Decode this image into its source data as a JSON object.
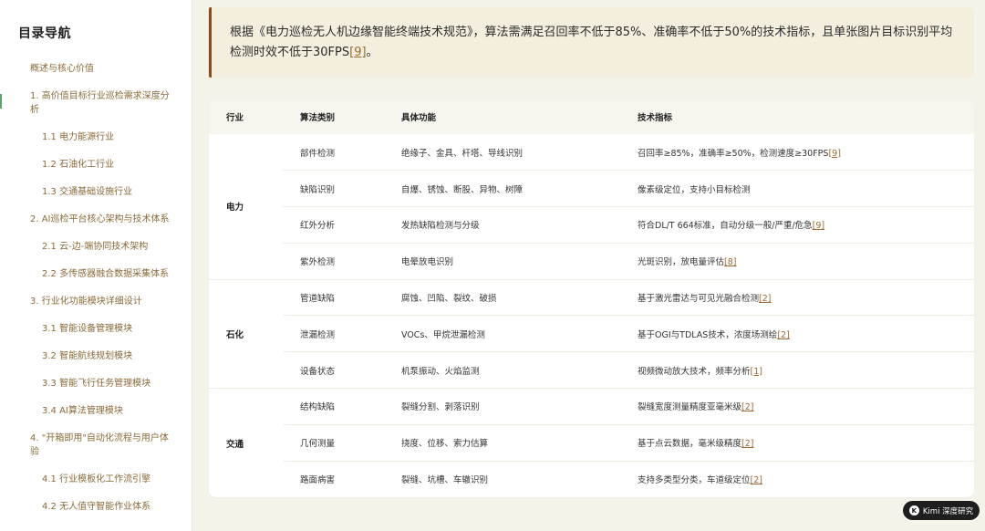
{
  "sidebar": {
    "title": "目录导航",
    "items": [
      {
        "label": "概述与核心价值",
        "level": 1
      },
      {
        "label": "1. 高价值目标行业巡检需求深度分析",
        "level": 1
      },
      {
        "label": "1.1 电力能源行业",
        "level": 2
      },
      {
        "label": "1.2 石油化工行业",
        "level": 2
      },
      {
        "label": "1.3 交通基础设施行业",
        "level": 2
      },
      {
        "label": "2. AI巡检平台核心架构与技术体系",
        "level": 1
      },
      {
        "label": "2.1 云-边-端协同技术架构",
        "level": 2
      },
      {
        "label": "2.2 多传感器融合数据采集体系",
        "level": 2
      },
      {
        "label": "3. 行业化功能模块详细设计",
        "level": 1
      },
      {
        "label": "3.1 智能设备管理模块",
        "level": 2
      },
      {
        "label": "3.2 智能航线规划模块",
        "level": 2
      },
      {
        "label": "3.3 智能飞行任务管理模块",
        "level": 2
      },
      {
        "label": "3.4 AI算法管理模块",
        "level": 2
      },
      {
        "label": "4. \"开箱即用\"自动化流程与用户体验",
        "level": 1
      },
      {
        "label": "4.1 行业模板化工作流引擎",
        "level": 2
      },
      {
        "label": "4.2 无人值守智能作业体系",
        "level": 2
      }
    ]
  },
  "callout": {
    "text": "根据《电力巡检无人机边缘智能终端技术规范》，算法需满足召回率不低于85%、准确率不低于50%的技术指标，且单张图片目标识别平均检测时效不低于30FPS",
    "ref": "[9]",
    "tail": "。"
  },
  "table": {
    "headers": [
      "行业",
      "算法类别",
      "具体功能",
      "技术指标"
    ],
    "groups": [
      {
        "industry": "电力",
        "rows": [
          {
            "category": "部件检测",
            "function": "绝缘子、金具、杆塔、导线识别",
            "spec": "召回率≥85%，准确率≥50%，检测速度≥30FPS",
            "ref": "[9]"
          },
          {
            "category": "缺陷识别",
            "function": "自爆、锈蚀、断股、异物、树障",
            "spec": "像素级定位，支持小目标检测",
            "ref": ""
          },
          {
            "category": "红外分析",
            "function": "发热缺陷检测与分级",
            "spec": "符合DL/T 664标准，自动分级一般/严重/危急",
            "ref": "[9]"
          },
          {
            "category": "紫外检测",
            "function": "电晕放电识别",
            "spec": "光斑识别，放电量评估",
            "ref": "[8]"
          }
        ]
      },
      {
        "industry": "石化",
        "rows": [
          {
            "category": "管道缺陷",
            "function": "腐蚀、凹陷、裂纹、破损",
            "spec": "基于激光雷达与可见光融合检测",
            "ref": "[2]"
          },
          {
            "category": "泄漏检测",
            "function": "VOCs、甲烷泄漏检测",
            "spec": "基于OGI与TDLAS技术，浓度场测绘",
            "ref": "[2]"
          },
          {
            "category": "设备状态",
            "function": "机泵振动、火焰监测",
            "spec": "视频微动放大技术，频率分析",
            "ref": "[1]"
          }
        ]
      },
      {
        "industry": "交通",
        "rows": [
          {
            "category": "结构缺陷",
            "function": "裂缝分割、剥落识别",
            "spec": "裂缝宽度测量精度亚毫米级",
            "ref": "[2]"
          },
          {
            "category": "几何测量",
            "function": "挠度、位移、索力估算",
            "spec": "基于点云数据，毫米级精度",
            "ref": "[2]"
          },
          {
            "category": "路面病害",
            "function": "裂缝、坑槽、车辙识别",
            "spec": "支持多类型分类，车道级定位",
            "ref": "[2]"
          }
        ]
      }
    ]
  },
  "badge": {
    "logo": "K",
    "text": "Kimi 深度研究"
  },
  "colors": {
    "accent": "#8a4a1e",
    "link": "#9c6a30",
    "background": "#f4f3ea"
  }
}
